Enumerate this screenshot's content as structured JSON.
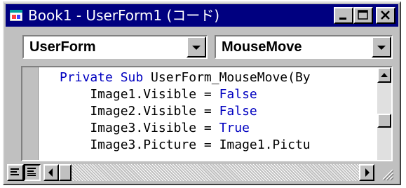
{
  "window": {
    "title": "Book1 - UserForm1 (コード)"
  },
  "titlebar_buttons": {
    "minimize_icon": "minimize-icon",
    "maximize_icon": "maximize-icon",
    "close_icon": "close-icon"
  },
  "object_combo": {
    "value": "UserForm"
  },
  "procedure_combo": {
    "value": "MouseMove"
  },
  "code": {
    "lines": [
      [
        {
          "t": "Private Sub",
          "kw": true
        },
        {
          "t": " UserForm_MouseMove(By",
          "kw": false
        }
      ],
      [
        {
          "t": "    Image1.Visible = ",
          "kw": false
        },
        {
          "t": "False",
          "kw": true
        }
      ],
      [
        {
          "t": "    Image2.Visible = ",
          "kw": false
        },
        {
          "t": "False",
          "kw": true
        }
      ],
      [
        {
          "t": "    Image3.Visible = ",
          "kw": false
        },
        {
          "t": "True",
          "kw": true
        }
      ],
      [
        {
          "t": "    Image3.Picture = Image1.Pictu",
          "kw": false
        }
      ]
    ],
    "keyword_color": "#0000c0"
  },
  "colors": {
    "title_bar": "#000080",
    "chrome": "#c0c0c0"
  }
}
